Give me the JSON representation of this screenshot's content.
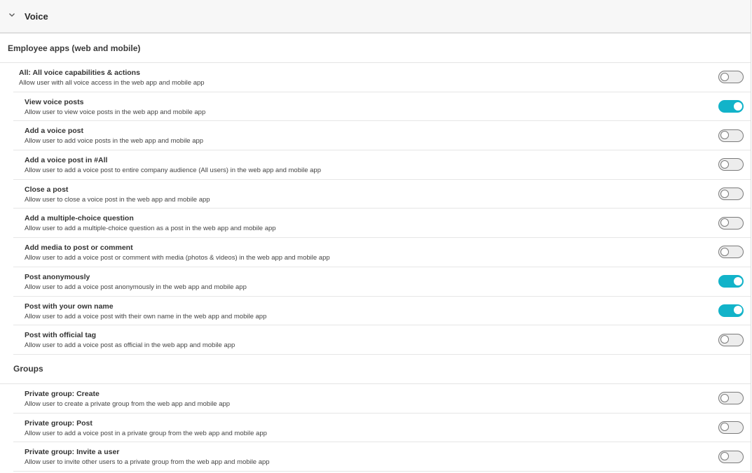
{
  "section": {
    "title": "Voice",
    "expand_icon": "chevron-down-icon"
  },
  "groups": [
    {
      "label": "Employee apps (web and mobile)",
      "rows": [
        {
          "title": "All: All voice capabilities & actions",
          "desc": "Allow user with all voice access in the web app and mobile app",
          "enabled": false
        },
        {
          "title": "View voice posts",
          "desc": "Allow user to view voice posts in the web app and mobile app",
          "enabled": true
        },
        {
          "title": "Add a voice post",
          "desc": "Allow user to add voice posts in the web app and mobile app",
          "enabled": false
        },
        {
          "title": "Add a voice post in #All",
          "desc": "Allow user to add a voice post to entire company audience (All users) in the web app and mobile app",
          "enabled": false
        },
        {
          "title": "Close a post",
          "desc": "Allow user to close a voice post in the web app and mobile app",
          "enabled": false
        },
        {
          "title": "Add a multiple-choice question",
          "desc": "Allow user to add a multiple-choice question as a post in the web app and mobile app",
          "enabled": false
        },
        {
          "title": "Add media to post or comment",
          "desc": "Allow user to add a voice post or comment with media (photos & videos) in the web app and mobile app",
          "enabled": false
        },
        {
          "title": "Post anonymously",
          "desc": "Allow user to add a voice post anonymously in the web app and mobile app",
          "enabled": true
        },
        {
          "title": "Post with your own name",
          "desc": "Allow user to add a voice post with their own name in the web app and mobile app",
          "enabled": true
        },
        {
          "title": "Post with official tag",
          "desc": "Allow user to add a voice post as official in the web app and mobile app",
          "enabled": false
        }
      ]
    },
    {
      "label": "Groups",
      "rows": [
        {
          "title": "Private group: Create",
          "desc": "Allow user to create a private group from the web app and mobile app",
          "enabled": false
        },
        {
          "title": "Private group: Post",
          "desc": "Allow user to add a voice post in a private group from the web app and mobile app",
          "enabled": false
        },
        {
          "title": "Private group: Invite a user",
          "desc": "Allow user to invite other users to a private group from the web app and mobile app",
          "enabled": false
        }
      ]
    }
  ],
  "colors": {
    "toggle_on": "#12b3c9",
    "toggle_off_border": "#7a7a7a",
    "header_bg": "#f7f7f7"
  }
}
